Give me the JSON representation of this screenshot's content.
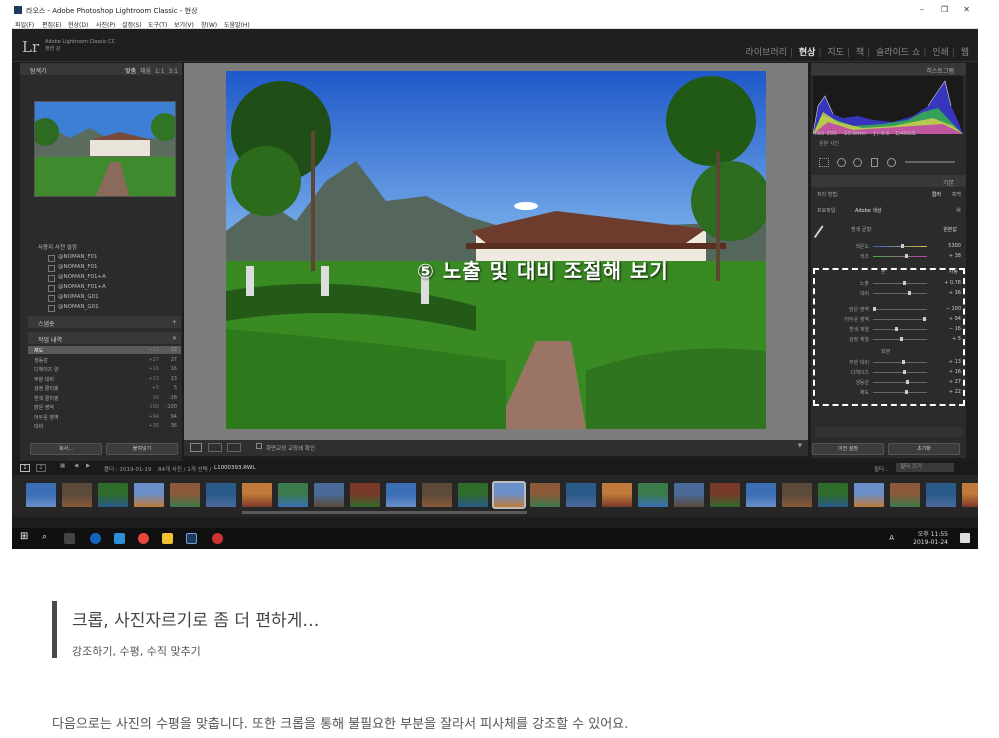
{
  "window": {
    "title": "라오스 - Adobe Photoshop Lightroom Classic - 현상",
    "menu": [
      "파일(F)",
      "편집(E)",
      "현상(D)",
      "사진(P)",
      "설정(S)",
      "도구(T)",
      "보기(V)",
      "창(W)",
      "도움말(H)"
    ],
    "controls": [
      "–",
      "❐",
      "✕"
    ]
  },
  "lightroom": {
    "logo": "Lr",
    "product": "Adobe Lightroom Classic CC",
    "user": "정현 강",
    "modules": [
      "라이브러리",
      "현상",
      "지도",
      "책",
      "슬라이드 쇼",
      "인쇄",
      "웹"
    ],
    "active_module": "현상"
  },
  "left_panel": {
    "navigator_label": "탐색기",
    "navigator_zoom": [
      "맞춤",
      "채움",
      "1:1",
      "3:1"
    ],
    "presets_header": "사용자 사전 설정",
    "presets": [
      "@NOMAN_F01",
      "@NOMAN_F01",
      "@NOMAN_F01+A",
      "@NOMAN_F01+A",
      "@NOMAN_G01",
      "@NOMAN_G01"
    ],
    "snapshots_label": "스냅숏",
    "history_label": "작업 내역",
    "history": [
      {
        "name": "채도",
        "a": "+22",
        "b": "22"
      },
      {
        "name": "생동감",
        "a": "+27",
        "b": "27"
      },
      {
        "name": "디헤이즈 양",
        "a": "+16",
        "b": "16"
      },
      {
        "name": "부분 대비",
        "a": "+13",
        "b": "13"
      },
      {
        "name": "검정 클리핑",
        "a": "+5",
        "b": "5"
      },
      {
        "name": "흰색 클리핑",
        "a": "-16",
        "b": "-16"
      },
      {
        "name": "밝은 영역",
        "a": "-100",
        "b": "-100"
      },
      {
        "name": "어두운 영역",
        "a": "+94",
        "b": "94"
      },
      {
        "name": "대비",
        "a": "+36",
        "b": "36"
      }
    ],
    "copy_button": "복사...",
    "paste_button": "붙여넣기"
  },
  "overlay_text": "⑤ 노출 및 대비 조절해 보기",
  "toolbar": {
    "soft_proof": "화면교정 교정쇄 확인"
  },
  "right_panel": {
    "histogram_label": "히스토그램",
    "exif": [
      "ISO 200",
      "10.9mm",
      "ƒ / 5.6",
      "1/400초"
    ],
    "original_photo": "원본 사진",
    "basic_label": "기본",
    "treatment": "처리 방법:",
    "treatment_options": [
      "컬러",
      "흑백"
    ],
    "profile_label": "프로파일:",
    "profile_value": "Adobe 색상",
    "wb_label": "흰색 균형:",
    "wb_value": "원본값",
    "temp": {
      "label": "색온도",
      "value": "5300"
    },
    "tint": {
      "label": "색조",
      "value": "+ 38"
    },
    "tone_label": "톤",
    "auto_label": "자동",
    "sliders": [
      {
        "label": "노출",
        "value": "+ 0.78",
        "pos": 0.57
      },
      {
        "label": "대비",
        "value": "+ 36",
        "pos": 0.68
      },
      {
        "label": "밝은 영역",
        "value": "− 100",
        "pos": 0.0
      },
      {
        "label": "어두운 영역",
        "value": "+ 94",
        "pos": 0.97
      },
      {
        "label": "흰색 계열",
        "value": "− 16",
        "pos": 0.42
      },
      {
        "label": "검정 계열",
        "value": "+ 5",
        "pos": 0.52
      }
    ],
    "presence_label": "외관",
    "presence": [
      {
        "label": "부분 대비",
        "value": "+ 13",
        "pos": 0.56
      },
      {
        "label": "디헤이즈",
        "value": "+ 16",
        "pos": 0.58
      },
      {
        "label": "생동감",
        "value": "+ 27",
        "pos": 0.63
      },
      {
        "label": "채도",
        "value": "+ 22",
        "pos": 0.61
      }
    ],
    "prev_button": "이전 설정",
    "reset_button": "초기화"
  },
  "filmstrip": {
    "source": "폴더 : 2019-01-19",
    "count": "84개 사진 / 1개 선택 /",
    "filename": "L1000393.RWL",
    "filter_label": "필터 :",
    "filter_value": "필터 끄기"
  },
  "taskbar": {
    "time": "오후 11:55",
    "date": "2019-01-24",
    "lang": "A"
  },
  "article": {
    "heading": "크롭, 사진자르기로 좀 더 편하게…",
    "subheading": "강조하기, 수평, 수직 맞추기",
    "paragraph": "다음으로는 사진의 수평을 맞춥니다. 또한 크롭을 통해 불필요한 부분을 잘라서 피사체를 강조할 수 있어요."
  }
}
